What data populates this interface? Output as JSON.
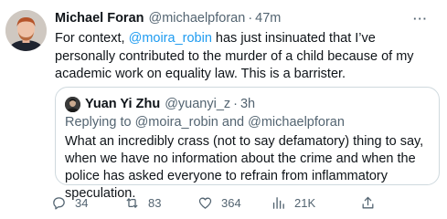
{
  "tweet": {
    "author_name": "Michael Foran",
    "author_handle": "@michaelpforan",
    "separator": "·",
    "time": "47m",
    "more_label": "···",
    "text_before": "For context, ",
    "mention": "@moira_robin",
    "text_after": " has just insinuated that I’ve personally contributed to the murder of a child because of my academic work on equality law. This is a barrister."
  },
  "quote": {
    "author_name": "Yuan Yi Zhu",
    "author_handle": "@yuanyi_z",
    "separator": "·",
    "time": "3h",
    "replying_prefix": "Replying to ",
    "replying_to_1": "@moira_robin",
    "replying_and": " and ",
    "replying_to_2": "@michaelpforan",
    "text": "What an incredibly crass (not to say defamatory) thing to say, when we have no information about the crime and when the police has asked everyone to refrain from inflammatory speculation."
  },
  "actions": {
    "replies": "34",
    "retweets": "83",
    "likes": "364",
    "views": "21K"
  },
  "colors": {
    "accent": "#1d9bf0",
    "secondary_text": "#536471",
    "border": "#cfd9de"
  },
  "icons": [
    "reply-icon",
    "retweet-icon",
    "like-icon",
    "views-icon",
    "share-icon",
    "more-icon"
  ]
}
